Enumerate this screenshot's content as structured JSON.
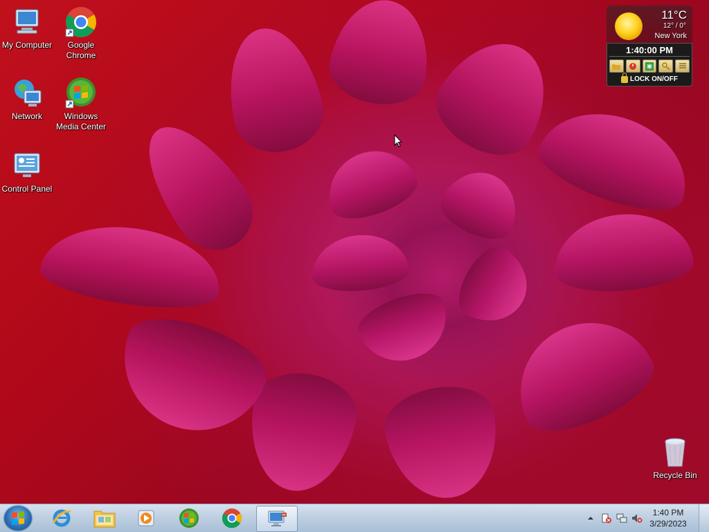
{
  "desktop": {
    "icons": [
      {
        "label": "My Computer",
        "icon": "computer-icon"
      },
      {
        "label": "Google Chrome",
        "icon": "chrome-icon"
      },
      {
        "label": "Network",
        "icon": "network-icon"
      },
      {
        "label": "Windows Media Center",
        "icon": "media-center-icon"
      },
      {
        "label": "Control Panel",
        "icon": "control-panel-icon"
      },
      {
        "label": "Recycle Bin",
        "icon": "recycle-bin-icon"
      }
    ]
  },
  "gadget": {
    "temperature": "11°C",
    "hilo": "12° / 0°",
    "city": "New York",
    "clock": "1:40:00 PM",
    "lock_label": "LOCK ON/OFF",
    "buttons": [
      "folder-icon",
      "power-icon",
      "settings-icon",
      "key-icon",
      "list-icon"
    ]
  },
  "taskbar": {
    "pinned": [
      "internet-explorer-icon",
      "explorer-folder-icon",
      "media-player-icon",
      "windows-logo-icon",
      "chrome-icon",
      "remote-desktop-icon"
    ],
    "time": "1:40 PM",
    "date": "3/29/2023"
  },
  "colors": {
    "wallpaper_base": "#b0081a",
    "petal_accent": "#e23a94",
    "taskbar": "#bfd0e2"
  }
}
